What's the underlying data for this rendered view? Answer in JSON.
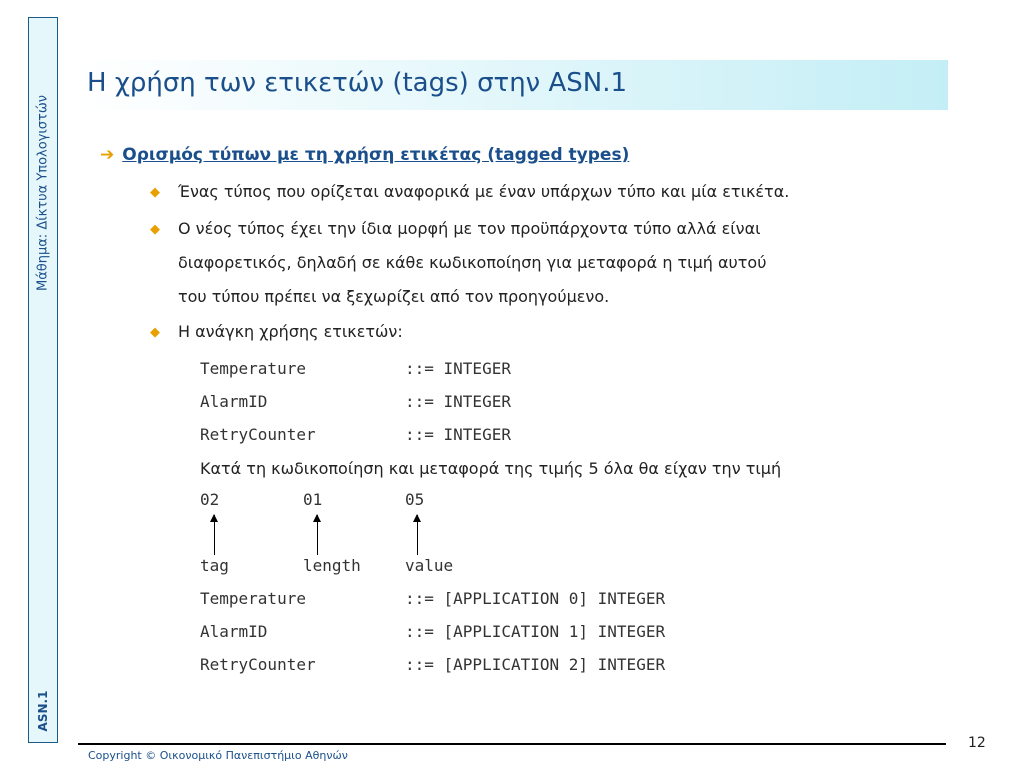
{
  "sidebar": {
    "course": "Μάθημα: Δίκτυα Υπολογιστών",
    "topic": "ASN.1"
  },
  "title": "Η χρήση των ετικετών (tags) στην ASN.1",
  "heading": {
    "arrow": "➔",
    "text": "Ορισμός τύπων με τη χρήση ετικέτας (tagged types)"
  },
  "bullets": {
    "symbol": "◆",
    "b1": "Ένας τύπος που ορίζεται αναφορικά με έναν υπάρχων τύπο και μία ετικέτα.",
    "b2": "Ο νέος τύπος έχει την ίδια μορφή με τον προϋπάρχοντα τύπο αλλά είναι",
    "b2_line2": "διαφορετικός, δηλαδή σε κάθε κωδικοποίηση για μεταφορά η τιμή αυτού",
    "b2_line3": "του τύπου πρέπει να ξεχωρίζει από τον προηγούμενο.",
    "b3": "Η ανάγκη χρήσης ετικετών:"
  },
  "code1": [
    {
      "name": "Temperature",
      "def": "::= INTEGER"
    },
    {
      "name": "AlarmID",
      "def": "::= INTEGER"
    },
    {
      "name": "RetryCounter",
      "def": "::= INTEGER"
    }
  ],
  "encoding_note": "Κατά τη κωδικοποίηση και μεταφορά της τιμής 5 όλα θα είχαν την τιμή",
  "bytes": [
    "02",
    "01",
    "05"
  ],
  "byte_labels": [
    "tag",
    "length",
    "value"
  ],
  "code2": [
    {
      "name": "Temperature",
      "def": "::= [APPLICATION 0] INTEGER"
    },
    {
      "name": "AlarmID",
      "def": "::= [APPLICATION 1] INTEGER"
    },
    {
      "name": "RetryCounter",
      "def": "::= [APPLICATION 2] INTEGER"
    }
  ],
  "footer": {
    "copyright": "Copyright © Οικονομικό Πανεπιστήμιο Αθηνών",
    "page": "12"
  }
}
